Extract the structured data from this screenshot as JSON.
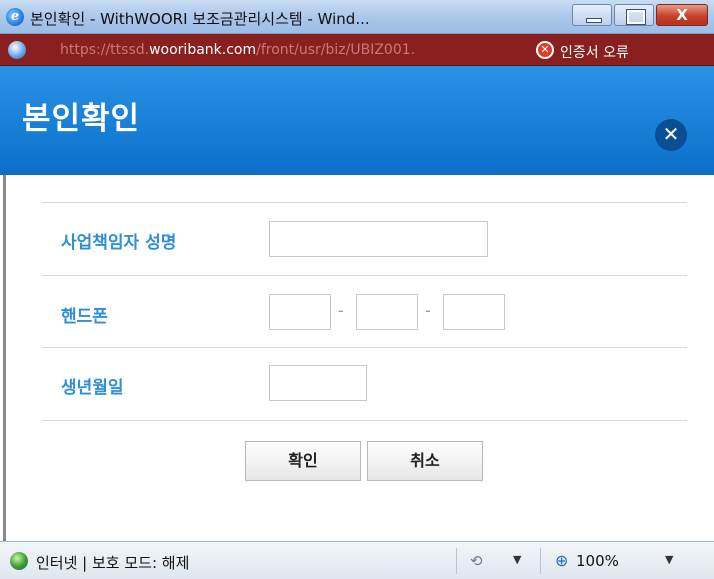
{
  "window": {
    "title": "본인확인 - WithWOORI 보조금관리시스템 - Wind...",
    "close_glyph": "X"
  },
  "address_bar": {
    "url_prefix": "https://ttssd.",
    "url_host": "wooribank.com",
    "url_path": "/front/usr/biz/UBIZ001.",
    "cert_error_label": "인증서 오류"
  },
  "dialog": {
    "title": "본인확인",
    "close_glyph": "✕",
    "fields": {
      "name_label": "사업책임자 성명",
      "phone_label": "핸드폰",
      "phone_separator": "-",
      "birth_label": "생년월일"
    },
    "buttons": {
      "confirm": "확인",
      "cancel": "취소"
    }
  },
  "status_bar": {
    "zone_text": "인터넷 | 보호 모드: 해제",
    "zoom": "100%",
    "dropdown_glyph": "▼"
  },
  "colors": {
    "dialog_header": "#1a82d9",
    "label_blue": "#2f8fd6",
    "address_bar_bg": "#8a1f1f"
  }
}
